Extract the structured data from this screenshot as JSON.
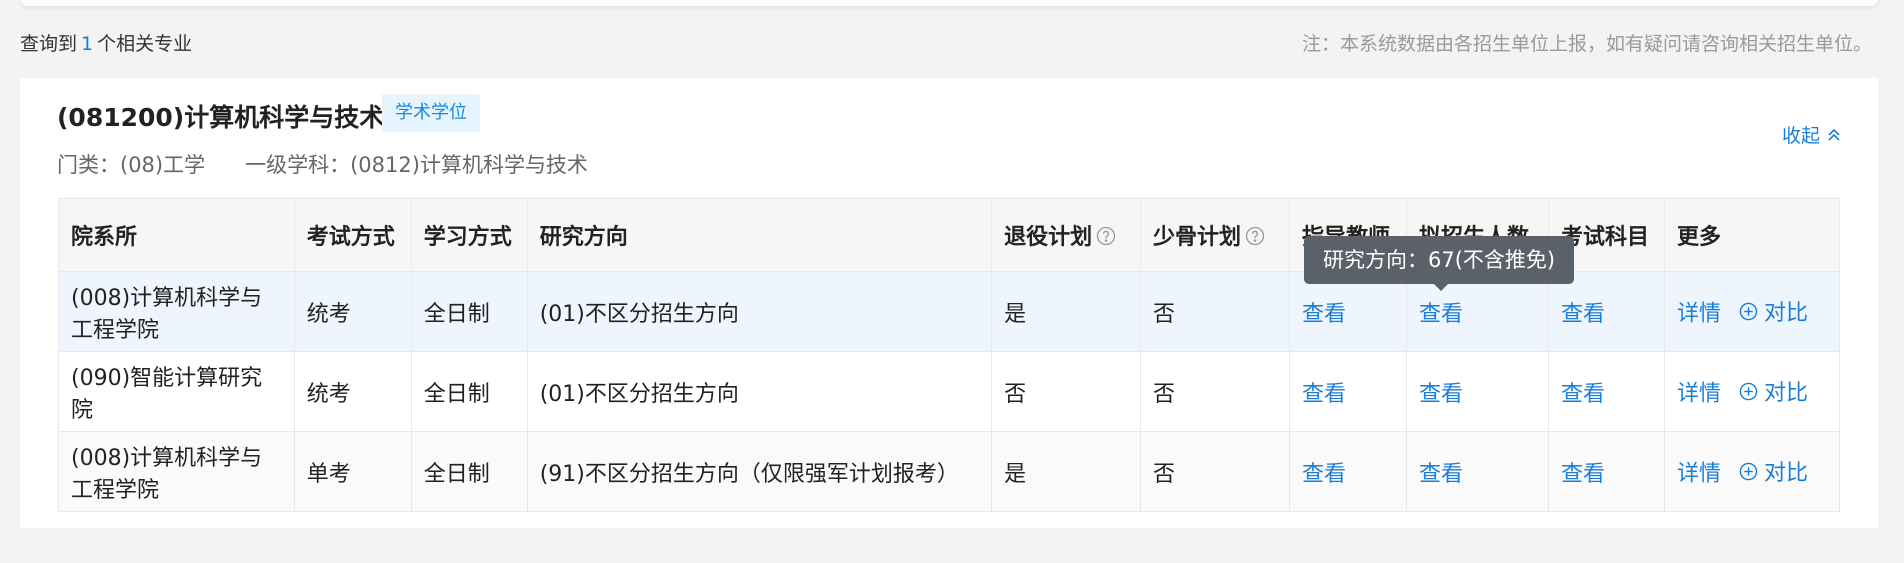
{
  "summary": {
    "prefix": "查询到",
    "count": "1",
    "suffix": "个相关专业"
  },
  "note": "注：本系统数据由各招生单位上报，如有疑问请咨询相关招生单位。",
  "major": {
    "title": "(081200)计算机科学与技术",
    "badge": "学术学位",
    "category": "门类：(08)工学",
    "discipline": "一级学科：(0812)计算机科学与技术",
    "collapse_label": "收起"
  },
  "table": {
    "headers": {
      "dept": "院系所",
      "exam_mode": "考试方式",
      "study_mode": "学习方式",
      "direction": "研究方向",
      "retired_plan": "退役计划",
      "minority_plan": "少骨计划",
      "tutor": "指导教师",
      "quota": "拟招生人数",
      "subjects": "考试科目",
      "more": "更多"
    },
    "rows": [
      {
        "dept": "(008)计算机科学与工程学院",
        "exam_mode": "统考",
        "study_mode": "全日制",
        "direction": "(01)不区分招生方向",
        "retired_plan": "是",
        "minority_plan": "否",
        "tutor": "查看",
        "quota": "查看",
        "subjects": "查看",
        "detail": "详情",
        "compare": "对比"
      },
      {
        "dept": "(090)智能计算研究院",
        "exam_mode": "统考",
        "study_mode": "全日制",
        "direction": "(01)不区分招生方向",
        "retired_plan": "否",
        "minority_plan": "否",
        "tutor": "查看",
        "quota": "查看",
        "subjects": "查看",
        "detail": "详情",
        "compare": "对比"
      },
      {
        "dept": "(008)计算机科学与工程学院",
        "exam_mode": "单考",
        "study_mode": "全日制",
        "direction": "(91)不区分招生方向（仅限强军计划报考）",
        "retired_plan": "是",
        "minority_plan": "否",
        "tutor": "查看",
        "quota": "查看",
        "subjects": "查看",
        "detail": "详情",
        "compare": "对比"
      }
    ]
  },
  "tooltip": "研究方向：67(不含推免)",
  "colors": {
    "accent": "#1a7ed8",
    "badge_bg": "#e6f4fd",
    "tooltip_bg": "#5b6168"
  }
}
